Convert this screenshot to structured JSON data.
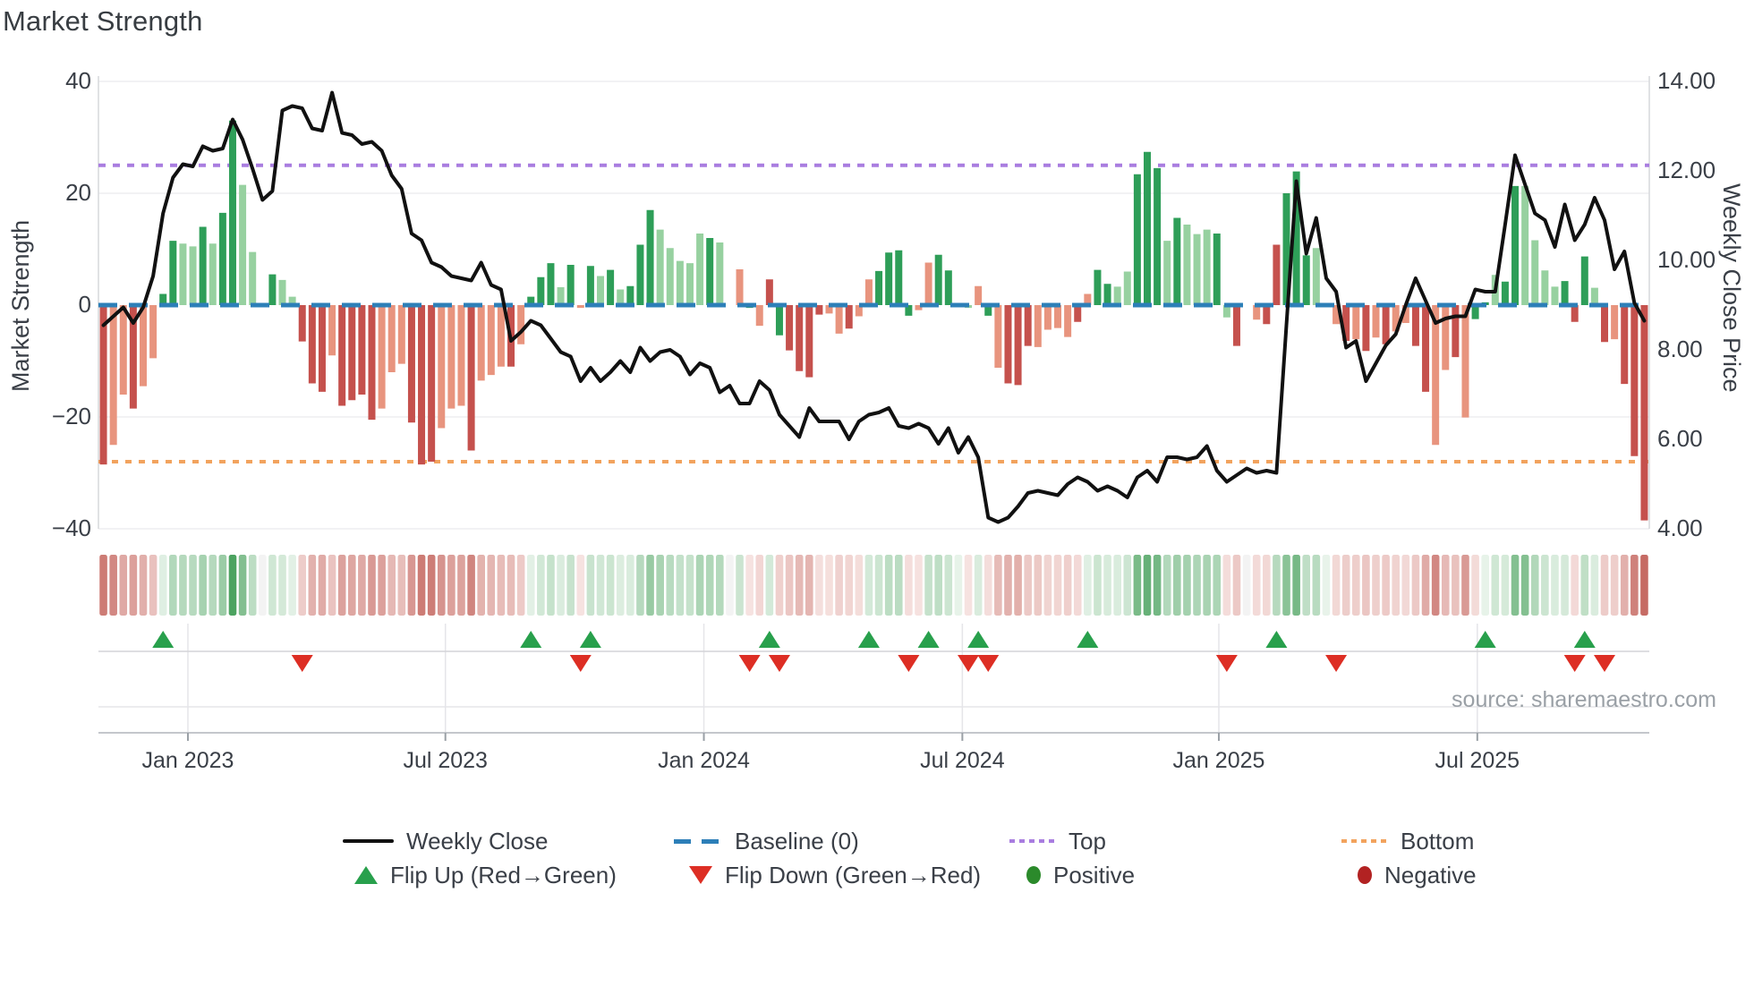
{
  "title": "Market Strength",
  "source": "source: sharemaestro.com",
  "colors": {
    "bar_dark_green": "#2e9e58",
    "bar_light_green": "#97d1a0",
    "bar_dark_red": "#c5514d",
    "bar_light_red": "#e8947e",
    "close_line": "#111111",
    "baseline": "#2d7fb8",
    "top_line": "#a97de0",
    "bottom_line": "#f2a35e",
    "flip_up": "#28a04c",
    "flip_down": "#dd2e24",
    "positive_dot": "#2b8a2b",
    "negative_dot": "#b22222",
    "heat_green": "#4ca360",
    "heat_red": "#c66b64",
    "grid": "#ededf1",
    "spine": "#d9dade",
    "lane_line": "#d4d4d8",
    "lane_line_faint": "#e5e5e9",
    "axis_line": "#c4c7cc",
    "tick_mark": "#9aa0a6"
  },
  "legend": {
    "row1": [
      {
        "label": "Weekly Close",
        "icon": "black-line"
      },
      {
        "label": "Baseline (0)",
        "icon": "blue-dashes"
      },
      {
        "label": "Top",
        "icon": "purple-dots"
      },
      {
        "label": "Bottom",
        "icon": "orange-dots"
      }
    ],
    "row2": [
      {
        "label": "Flip Up (Red→Green)",
        "icon": "green-triangle-up"
      },
      {
        "label": "Flip Down (Green→Red)",
        "icon": "red-triangle-down"
      },
      {
        "label": "Positive",
        "icon": "green-dot"
      },
      {
        "label": "Negative",
        "icon": "dark-red-dot"
      }
    ]
  },
  "chart_data": {
    "type": "combo-bar-line-heatmap",
    "weeks": 156,
    "x_axis": {
      "tick_labels": [
        "Jan 2023",
        "Jul 2023",
        "Jan 2024",
        "Jul 2024",
        "Jan 2025",
        "Jul 2025"
      ],
      "tick_weeks": [
        8.5,
        34.4,
        60.4,
        86.4,
        112.2,
        138.2
      ]
    },
    "y_left": {
      "label": "Market Strength",
      "tick_labels": [
        "40",
        "20",
        "0",
        "−20",
        "−40"
      ],
      "tick_values": [
        40,
        20,
        0,
        -20,
        -40
      ],
      "range": [
        -40,
        40
      ],
      "gridlines": [
        40,
        20,
        -20,
        -40
      ]
    },
    "y_right": {
      "label": "Weekly Close Price",
      "tick_labels": [
        "14.00",
        "12.00",
        "10.00",
        "8.00",
        "6.00",
        "4.00"
      ],
      "tick_values": [
        14,
        12,
        10,
        8,
        6,
        4
      ],
      "range": [
        4,
        14
      ]
    },
    "reference_lines": {
      "baseline": {
        "label": "Baseline (0)",
        "value": 0
      },
      "top": {
        "label": "Top",
        "value": 25
      },
      "bottom": {
        "label": "Bottom",
        "value": -28
      }
    },
    "strength_bars": {
      "name": "Market Strength",
      "values": [
        -28.5,
        -25,
        -16,
        -18.5,
        -14.5,
        -9.5,
        2,
        11.5,
        11,
        10.5,
        14,
        11,
        16.5,
        33,
        21.5,
        9.5,
        0,
        5.5,
        4.5,
        1.5,
        -6.5,
        -14,
        -15.5,
        -9,
        -18,
        -17,
        -16,
        -20.5,
        -18.5,
        -12,
        -10.5,
        -21,
        -28.5,
        -28,
        -22,
        -18.5,
        -18,
        -26,
        -13.5,
        -12.5,
        -11,
        -11,
        -7,
        1.5,
        5,
        7.5,
        3.2,
        7.2,
        -0.5,
        7,
        5.2,
        6.3,
        2.8,
        3.4,
        10.8,
        17,
        13.5,
        10.2,
        7.9,
        7.5,
        12.8,
        12,
        11.2,
        0,
        6.4,
        -0.5,
        -3.7,
        4.6,
        -5.4,
        -8.1,
        -11.8,
        -12.9,
        -1.7,
        -1.5,
        -5.1,
        -4.2,
        -2,
        4.6,
        6.1,
        9.4,
        9.8,
        -1.9,
        -0.9,
        7.6,
        9,
        6.2,
        0.4,
        -0.5,
        3.4,
        -1.9,
        -11.2,
        -14,
        -14.3,
        -7.3,
        -7.5,
        -4.4,
        -4.1,
        -5.7,
        -3,
        2,
        6.3,
        3.8,
        3.3,
        6,
        23.4,
        27.4,
        24.5,
        11.5,
        15.6,
        14.4,
        12.7,
        13.5,
        12.8,
        -2.2,
        -7.3,
        0,
        -2.6,
        -3.4,
        10.8,
        20,
        23.9,
        8.9,
        10.2,
        0.3,
        -3.4,
        -6.4,
        -6.1,
        -8.2,
        -5.8,
        -7,
        -4.7,
        -3.2,
        -7.3,
        -15.5,
        -25,
        -11.6,
        -9.3,
        -20.1,
        -2.5,
        0.5,
        5.4,
        4.2,
        21.3,
        21.3,
        11.6,
        6.2,
        3.3,
        4.3,
        -3,
        8.7,
        3.1,
        -6.6,
        -6.1,
        -14.1,
        -27,
        -38.5
      ],
      "shades": "RrrRrrGGggGgGGggzGggRRRrRRRRrrrRRRrrrRrrrRrGGGgGrGgGgGGGgggggGggzGrRGRRRRrrRrrGGGGrrGGggrGrRRRrrrrRrGGggGGGgGgggGgRRzRRGGGggrRrRrRrrRRrrRrGGgGGggggGRGgRrRRR",
      "shade_legend": {
        "G": "dark green",
        "g": "light green",
        "R": "dark red",
        "r": "light red",
        "z": "zero"
      }
    },
    "weekly_close": {
      "name": "Weekly Close",
      "values": [
        8.55,
        8.75,
        8.95,
        8.6,
        8.95,
        9.65,
        11.05,
        11.85,
        12.15,
        12.1,
        12.55,
        12.45,
        12.5,
        13.15,
        12.7,
        12.05,
        11.35,
        11.55,
        13.35,
        13.45,
        13.4,
        12.95,
        12.9,
        13.75,
        12.85,
        12.8,
        12.6,
        12.65,
        12.45,
        11.9,
        11.6,
        10.6,
        10.45,
        9.95,
        9.85,
        9.65,
        9.6,
        9.55,
        9.95,
        9.45,
        9.35,
        8.2,
        8.4,
        8.65,
        8.55,
        8.25,
        7.95,
        7.85,
        7.3,
        7.6,
        7.3,
        7.5,
        7.75,
        7.5,
        8.05,
        7.75,
        7.95,
        8.0,
        7.85,
        7.45,
        7.7,
        7.6,
        7.05,
        7.2,
        6.8,
        6.8,
        7.3,
        7.1,
        6.55,
        6.3,
        6.05,
        6.7,
        6.4,
        6.4,
        6.4,
        6.0,
        6.4,
        6.55,
        6.6,
        6.7,
        6.3,
        6.25,
        6.35,
        6.25,
        5.9,
        6.25,
        5.7,
        6.05,
        5.6,
        4.25,
        4.15,
        4.25,
        4.5,
        4.8,
        4.85,
        4.8,
        4.75,
        5.0,
        5.15,
        5.05,
        4.85,
        4.95,
        4.85,
        4.7,
        5.15,
        5.3,
        5.05,
        5.6,
        5.6,
        5.55,
        5.6,
        5.85,
        5.3,
        5.05,
        5.2,
        5.35,
        5.25,
        5.3,
        5.25,
        8.55,
        11.77,
        10.15,
        10.95,
        9.6,
        9.3,
        8.05,
        8.2,
        7.3,
        7.7,
        8.1,
        8.35,
        9.0,
        9.6,
        9.1,
        8.6,
        8.7,
        8.75,
        8.75,
        9.35,
        9.3,
        9.3,
        10.8,
        12.35,
        11.7,
        11.05,
        10.9,
        10.3,
        11.25,
        10.45,
        10.8,
        11.4,
        10.9,
        9.8,
        10.2,
        9.05,
        8.65
      ]
    },
    "flip_up": {
      "name": "Flip Up (Red→Green)",
      "weeks": [
        6,
        43,
        49,
        67,
        77,
        83,
        88,
        99,
        118,
        139,
        149
      ]
    },
    "flip_down": {
      "name": "Flip Down (Green→Red)",
      "weeks": [
        20,
        48,
        65,
        68,
        81,
        87,
        89,
        113,
        124,
        148,
        151
      ]
    },
    "heatmap": {
      "name": "Strength Heatmap",
      "source_series": "strength_bars",
      "max_intensity": 33
    }
  }
}
